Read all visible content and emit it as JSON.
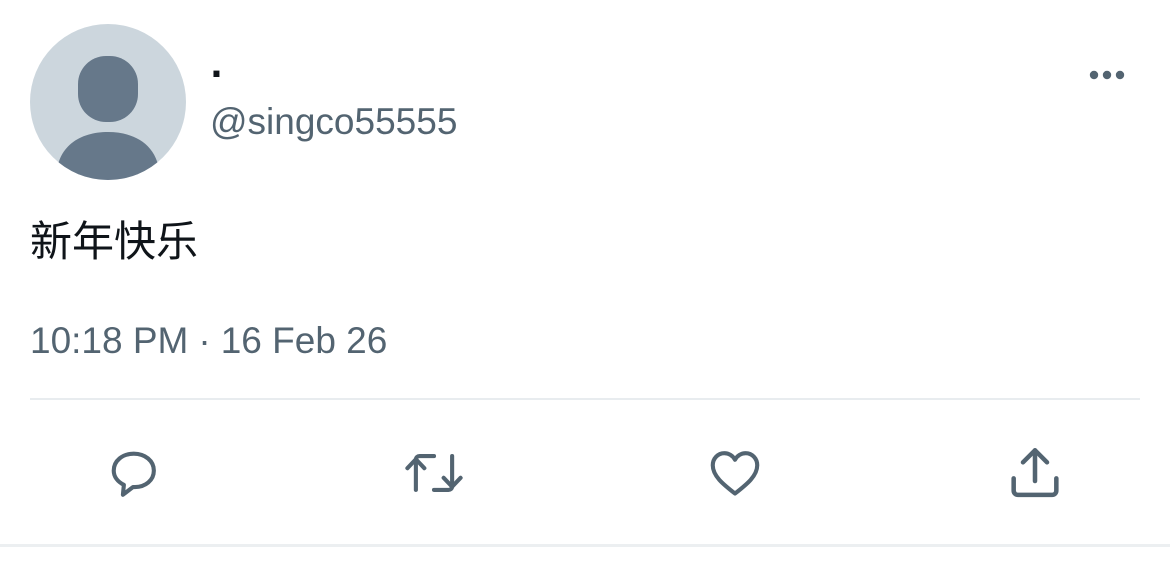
{
  "user": {
    "display_name": ".",
    "handle": "@singco55555",
    "avatar_icon": "default-profile-icon"
  },
  "tweet": {
    "text": "新年快乐",
    "time": "10:18 PM",
    "separator": "·",
    "date": "16 Feb 26"
  },
  "actions": [
    {
      "name": "reply",
      "icon": "reply-bubble-icon"
    },
    {
      "name": "retweet",
      "icon": "retweet-arrows-icon"
    },
    {
      "name": "like",
      "icon": "heart-icon"
    },
    {
      "name": "share",
      "icon": "share-upload-icon"
    }
  ],
  "menu": {
    "icon": "more-dots-icon"
  },
  "colors": {
    "text_primary": "#0f1419",
    "text_secondary": "#536471",
    "icon": "#536471",
    "avatar_bg": "#ccd6dd",
    "avatar_figure": "#66788a",
    "divider": "#e8ecef"
  }
}
